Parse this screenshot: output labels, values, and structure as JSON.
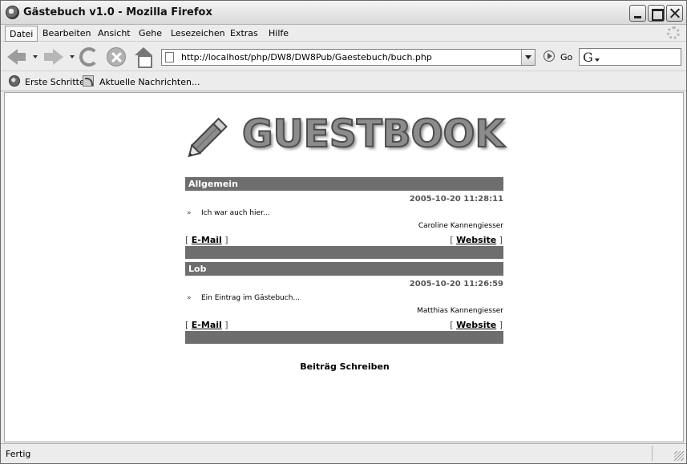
{
  "window": {
    "title": "Gästebuch v1.0 - Mozilla Firefox"
  },
  "menu": {
    "items": [
      "Datei",
      "Bearbeiten",
      "Ansicht",
      "Gehe",
      "Lesezeichen",
      "Extras",
      "Hilfe"
    ]
  },
  "navbar": {
    "url": "http://localhost/php/DW8/DW8Pub/Gaestebuch/buch.php",
    "go_label": "Go"
  },
  "bookmarks": {
    "items": [
      "Erste Schritte",
      "Aktuelle Nachrichten..."
    ]
  },
  "page": {
    "logo_text": "GUESTBOOK",
    "entries": [
      {
        "subject": "Allgemein",
        "date": "2005-10-20 11:28:11",
        "marker": "»",
        "message": "Ich war auch hier...",
        "author": "Caroline Kannengiesser",
        "email_label": "E-Mail",
        "website_label": "Website"
      },
      {
        "subject": "Lob",
        "date": "2005-10-20 11:26:59",
        "marker": "»",
        "message": "Ein Eintrag im Gästebuch...",
        "author": "Matthias Kannengiesser",
        "email_label": "E-Mail",
        "website_label": "Website"
      }
    ],
    "bracket_open": "[",
    "bracket_close": "]",
    "write_link": "Beiträg Schreiben"
  },
  "statusbar": {
    "text": "Fertig"
  },
  "icons": {
    "app": "firefox-logo-icon",
    "back": "back-arrow-icon",
    "forward": "forward-arrow-icon",
    "reload": "reload-icon",
    "stop": "stop-icon",
    "home": "home-icon",
    "go": "go-icon",
    "search_engine": "google-icon",
    "throbber": "throbber-icon",
    "bookmark_firefox": "firefox-bookmark-icon",
    "bookmark_rss": "rss-feed-icon",
    "logo_pencil": "pencil-icon"
  }
}
